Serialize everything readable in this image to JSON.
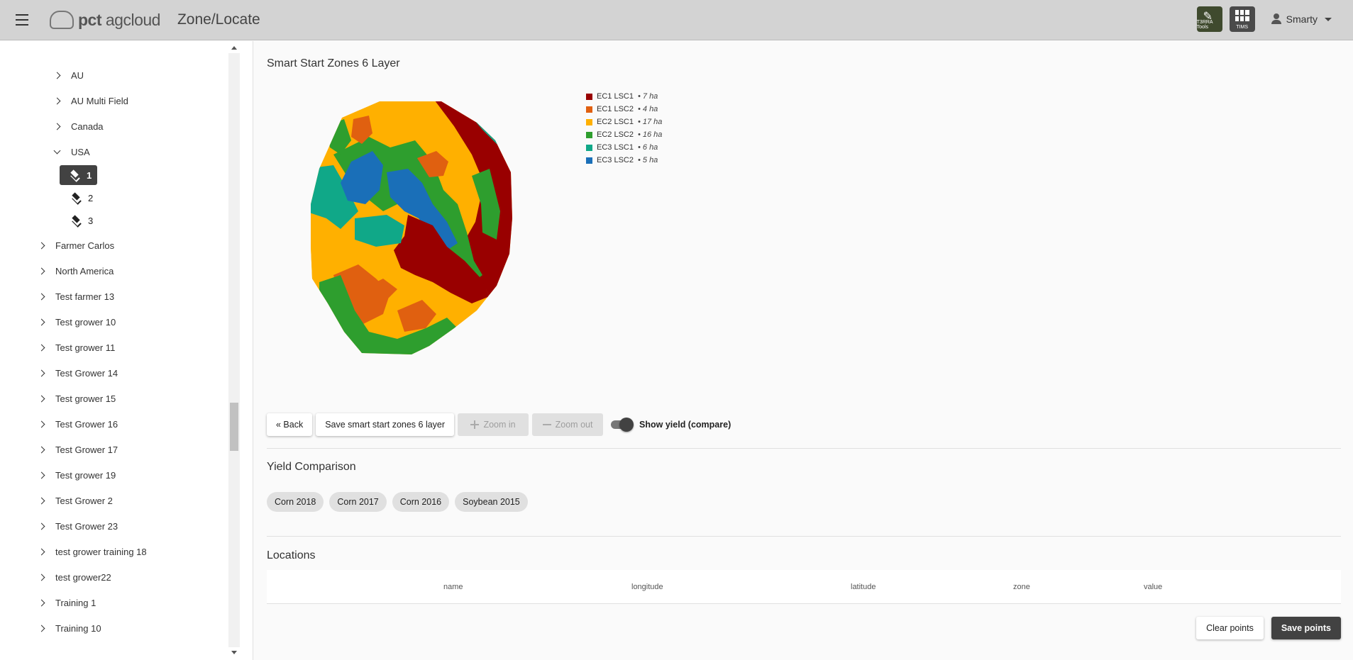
{
  "header": {
    "logo_prefix": "pct",
    "logo_suffix": "agcloud",
    "title": "Zone/Locate",
    "terra_tools_label": "T3RRA Tools",
    "apps_label": "TIMS",
    "user_name": "Smarty"
  },
  "sidebar": {
    "level1_items": [
      "AU",
      "AU Multi Field",
      "Canada",
      "USA"
    ],
    "layers": [
      "1",
      "2",
      "3"
    ],
    "level0_items": [
      "Farmer Carlos",
      "North America",
      "Test farmer 13",
      "Test grower 10",
      "Test grower 11",
      "Test Grower 14",
      "Test grower 15",
      "Test Grower 16",
      "Test Grower 17",
      "Test grower 19",
      "Test Grower 2",
      "Test Grower 23",
      "test grower training 18",
      "test grower22",
      "Training 1",
      "Training 10"
    ]
  },
  "main": {
    "map_title": "Smart Start Zones 6 Layer",
    "legend": [
      {
        "label": "EC1 LSC1",
        "value": "• 7 ha",
        "color": "#990000"
      },
      {
        "label": "EC1 LSC2",
        "value": "• 4 ha",
        "color": "#e06010"
      },
      {
        "label": "EC2 LSC1",
        "value": "• 17 ha",
        "color": "#ffb000"
      },
      {
        "label": "EC2 LSC2",
        "value": "• 16 ha",
        "color": "#2e9e2e"
      },
      {
        "label": "EC3 LSC1",
        "value": "• 6 ha",
        "color": "#10a888"
      },
      {
        "label": "EC3 LSC2",
        "value": "• 5 ha",
        "color": "#1a6fb8"
      }
    ],
    "buttons": {
      "back": "« Back",
      "save_layer": "Save smart start zones 6 layer",
      "zoom_in": "Zoom in",
      "zoom_out": "Zoom out",
      "show_yield": "Show yield (compare)"
    },
    "yield_title": "Yield Comparison",
    "yield_chips": [
      "Corn 2018",
      "Corn 2017",
      "Corn 2016",
      "Soybean 2015"
    ],
    "locations_title": "Locations",
    "table_columns": [
      "name",
      "longitude",
      "latitude",
      "zone",
      "value"
    ],
    "clear_points": "Clear points",
    "save_points": "Save points"
  }
}
